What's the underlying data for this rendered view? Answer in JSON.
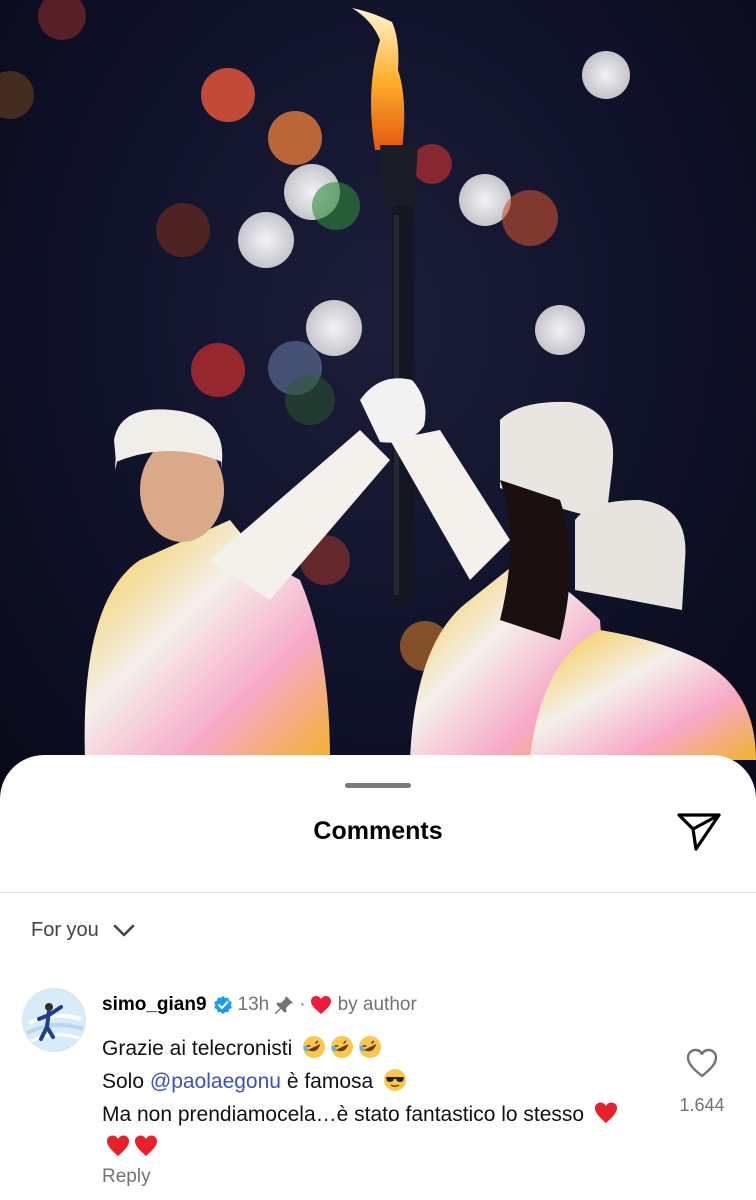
{
  "photo": {
    "description_icon": "torch-relay-photo"
  },
  "sheet": {
    "title": "Comments",
    "share_icon": "send-icon"
  },
  "filter": {
    "label": "For you",
    "icon": "chevron-down-icon"
  },
  "comment": {
    "username": "simo_gian9",
    "verified": true,
    "time": "13h",
    "pinned": true,
    "separator": "·",
    "liked_by_author_label": "by author",
    "line1": "Grazie ai telecronisti",
    "line2_before": "Solo ",
    "mention": "@paolaegonu",
    "line2_after": " è famosa",
    "line3": "Ma non prendiamocela…è stato fantastico lo stesso",
    "like_count": "1.644",
    "reply_label": "Reply"
  },
  "colors": {
    "accent_link": "#3b4fc4",
    "heart_red": "#ed1c3a",
    "verified_blue": "#1d9bf0",
    "secondary_text": "#737373"
  }
}
